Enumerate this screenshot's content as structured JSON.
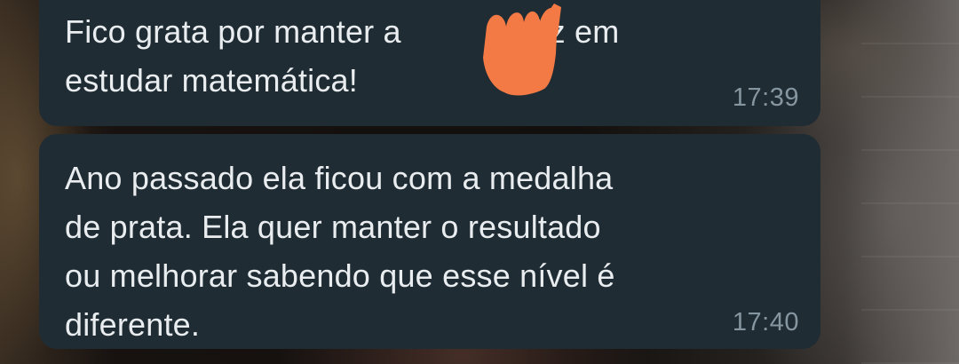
{
  "messages": [
    {
      "line1_before": "Fico grata por manter a",
      "line1_after": "feliz em",
      "line2": "estudar matemática!",
      "time": "17:39"
    },
    {
      "lines": [
        "Ano passado ela ficou com a medalha",
        "de prata. Ela quer manter o resultado",
        "ou melhorar sabendo que esse nível é",
        "diferente."
      ],
      "time": "17:40"
    }
  ],
  "colors": {
    "bubble": "#1f2c34",
    "text": "#e9edef",
    "timestamp": "#8696a0",
    "redaction": "#f47a45"
  },
  "icons": {
    "redaction": "orange-scribble-redaction"
  }
}
